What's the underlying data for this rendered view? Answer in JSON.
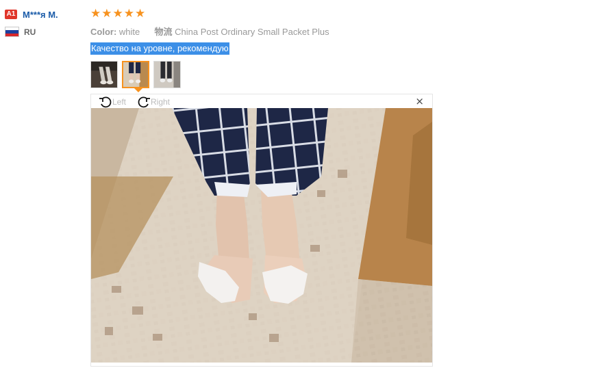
{
  "user": {
    "badge": "A1",
    "name": "М***я М.",
    "country": "RU",
    "flag_colors": [
      "#ffffff",
      "#1c3f9e",
      "#d7262b"
    ]
  },
  "review": {
    "rating": 5,
    "stars": [
      "★",
      "★",
      "★",
      "★",
      "★"
    ],
    "star_color": "#f7921e",
    "color_label": "Color:",
    "color_value": "white",
    "shipping_label": "物流",
    "shipping_value": "China Post Ordinary Small Packet Plus",
    "comment": "Качество на уровне, рекомендую",
    "comment_highlight": "#3c8fe7",
    "thumbnails": [
      "photo-1",
      "photo-2",
      "photo-3"
    ],
    "selected_thumbnail": 2
  },
  "viewer": {
    "rotate_left_label": "Left",
    "rotate_right_label": "Right",
    "close_icon": "×"
  }
}
